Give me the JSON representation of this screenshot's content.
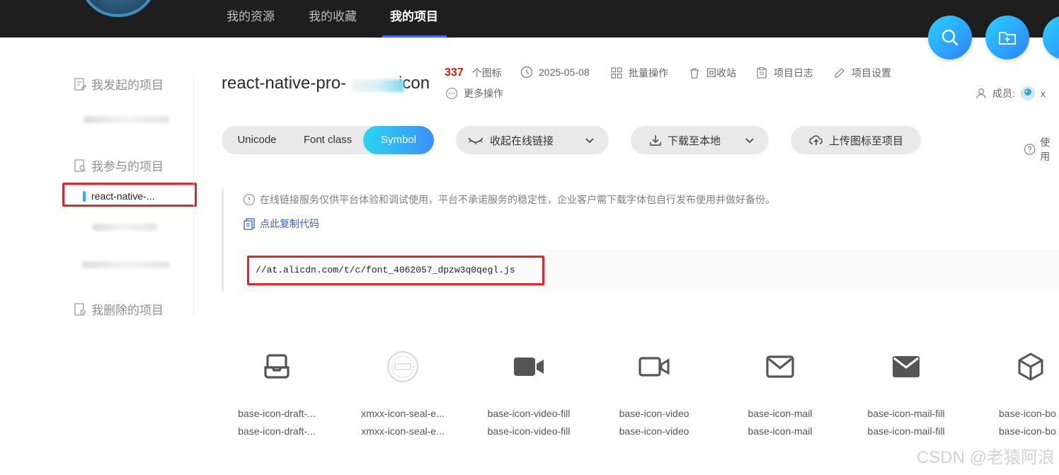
{
  "nav": {
    "tabs": [
      "我的资源",
      "我的收藏",
      "我的项目"
    ],
    "active_tab": "我的项目"
  },
  "fab_icons": [
    "search-icon",
    "add-folder-icon",
    "upload-icon"
  ],
  "sidebar": {
    "started_title": "我发起的项目",
    "joined_title": "我参与的项目",
    "joined_active_item": "react-native-...",
    "deleted_title": "我删除的项目"
  },
  "project": {
    "title": "react-native-pro-",
    "title_suffix": "icon",
    "icon_count": "337",
    "icon_count_label": "个图标",
    "date": "2025-05-08",
    "batch_label": "批量操作",
    "recycle_label": "回收站",
    "log_label": "项目日志",
    "settings_label": "项目设置",
    "more_label": "更多操作",
    "members_label": "成员:",
    "members_initial": "x"
  },
  "format_tabs": {
    "items": [
      "Unicode",
      "Font class",
      "Symbol"
    ],
    "active": "Symbol"
  },
  "actions": {
    "collapse_link": "收起在线链接",
    "download": "下载至本地",
    "upload": "上传图标至项目",
    "usage": "使用"
  },
  "notice": {
    "text": "在线链接服务仅供平台体验和调试使用，平台不承诺服务的稳定性，企业客户需下载字体包自行发布使用并做好备份。",
    "copy_label": "点此复制代码",
    "code_url": "//at.alicdn.com/t/c/font_4062057_dpzw3q0qegl.js"
  },
  "icons": [
    {
      "name": "base-icon-draft-...",
      "code": "base-icon-draft-...",
      "glyph": "draft-icon"
    },
    {
      "name": "xmxx-icon-seal-e...",
      "code": "xmxx-icon-seal-e...",
      "glyph": "seal-icon"
    },
    {
      "name": "base-icon-video-fill",
      "code": "base-icon-video-fill",
      "glyph": "video-fill-icon"
    },
    {
      "name": "base-icon-video",
      "code": "base-icon-video",
      "glyph": "video-icon"
    },
    {
      "name": "base-icon-mail",
      "code": "base-icon-mail",
      "glyph": "mail-icon"
    },
    {
      "name": "base-icon-mail-fill",
      "code": "base-icon-mail-fill",
      "glyph": "mail-fill-icon"
    },
    {
      "name": "base-icon-bo",
      "code": "base-icon-bo",
      "glyph": "box-icon"
    }
  ],
  "watermark": "CSDN @老猿阿浪",
  "colors": {
    "accent": "#3c8ffa",
    "highlight": "#e0262a",
    "count": "#d81e06"
  }
}
